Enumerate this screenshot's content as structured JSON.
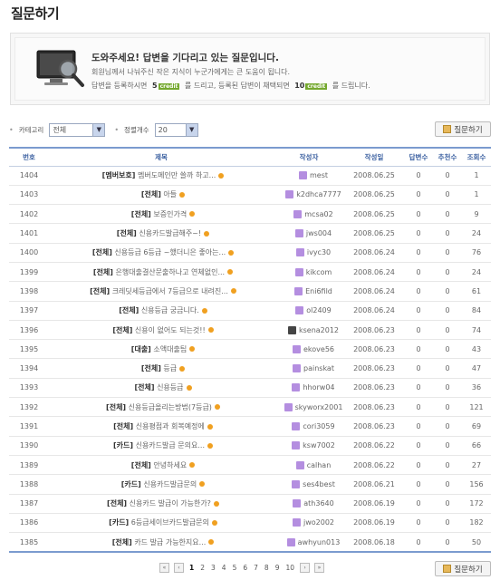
{
  "page": {
    "title": "질문하기"
  },
  "banner": {
    "title": "도와주세요! 답변을 기다리고 있는 질문입니다.",
    "line1": "회원님께서 나눠주신 작은 지식이 누군가에게는 큰 도움이 됩니다.",
    "line2_prefix": "답변을 등록하시면",
    "line2_credit1": "5",
    "line2_mid": "를 드리고, 등록된 답변이 채택되면",
    "line2_credit2": "10",
    "line2_suffix": "를 드립니다.",
    "credit_unit": "credit"
  },
  "filters": {
    "category_label": "카테고리",
    "category_value": "전체",
    "count_label": "정렬개수",
    "count_value": "20"
  },
  "buttons": {
    "ask": "질문하기"
  },
  "table": {
    "headers": {
      "no": "번호",
      "title": "제목",
      "author": "작성자",
      "date": "작성일",
      "answers": "답변수",
      "recommend": "추천수",
      "views": "조회수"
    },
    "rows": [
      {
        "no": "1404",
        "cat": "[멤버보호]",
        "title": "멤버도메인만 쓸까 하고...",
        "new": true,
        "author": "mest",
        "level": "purple",
        "date": "2008.06.25",
        "answers": "0",
        "recommend": "0",
        "views": "1"
      },
      {
        "no": "1403",
        "cat": "[전체]",
        "title": "아들",
        "new": true,
        "author": "k2dhca7777",
        "level": "purple",
        "date": "2008.06.25",
        "answers": "0",
        "recommend": "0",
        "views": "1"
      },
      {
        "no": "1402",
        "cat": "[전체]",
        "title": "보증인가격",
        "new": true,
        "author": "mcsa02",
        "level": "purple",
        "date": "2008.06.25",
        "answers": "0",
        "recommend": "0",
        "views": "9"
      },
      {
        "no": "1401",
        "cat": "[전체]",
        "title": "신용카드발급해주~!",
        "new": true,
        "author": "jws004",
        "level": "purple",
        "date": "2008.06.25",
        "answers": "0",
        "recommend": "0",
        "views": "24"
      },
      {
        "no": "1400",
        "cat": "[전체]",
        "title": "신용등급 6등급 ~했더니은 좋아는...",
        "new": true,
        "author": "ivyc30",
        "level": "purple",
        "date": "2008.06.24",
        "answers": "0",
        "recommend": "0",
        "views": "76"
      },
      {
        "no": "1399",
        "cat": "[전체]",
        "title": "은행대출결산문출하나고 연체없인...",
        "new": true,
        "author": "kikcom",
        "level": "purple",
        "date": "2008.06.24",
        "answers": "0",
        "recommend": "0",
        "views": "24"
      },
      {
        "no": "1398",
        "cat": "[전체]",
        "title": "크레딧세등급에서 7등급으로 내려진...",
        "new": true,
        "author": "Eni6fild",
        "level": "purple",
        "date": "2008.06.24",
        "answers": "0",
        "recommend": "0",
        "views": "61"
      },
      {
        "no": "1397",
        "cat": "[전체]",
        "title": "신용등급 궁금니다.",
        "new": true,
        "author": "ol2409",
        "level": "purple",
        "date": "2008.06.24",
        "answers": "0",
        "recommend": "0",
        "views": "84"
      },
      {
        "no": "1396",
        "cat": "[전체]",
        "title": "신용이 없어도 되는것!!",
        "new": true,
        "author": "ksena2012",
        "level": "dark",
        "date": "2008.06.23",
        "answers": "0",
        "recommend": "0",
        "views": "74"
      },
      {
        "no": "1395",
        "cat": "[대출]",
        "title": "소액대출팁",
        "new": true,
        "author": "ekove56",
        "level": "purple",
        "date": "2008.06.23",
        "answers": "0",
        "recommend": "0",
        "views": "43"
      },
      {
        "no": "1394",
        "cat": "[전체]",
        "title": "등급",
        "new": true,
        "author": "painskat",
        "level": "purple",
        "date": "2008.06.23",
        "answers": "0",
        "recommend": "0",
        "views": "47"
      },
      {
        "no": "1393",
        "cat": "[전체]",
        "title": "신용등급",
        "new": true,
        "author": "hhorw04",
        "level": "purple",
        "date": "2008.06.23",
        "answers": "0",
        "recommend": "0",
        "views": "36"
      },
      {
        "no": "1392",
        "cat": "[전체]",
        "title": "신용등급올리는방법(7등급)",
        "new": true,
        "author": "skyworx2001",
        "level": "purple",
        "date": "2008.06.23",
        "answers": "0",
        "recommend": "0",
        "views": "121"
      },
      {
        "no": "1391",
        "cat": "[전체]",
        "title": "신용평점과 회복예정에",
        "new": true,
        "author": "cori3059",
        "level": "purple",
        "date": "2008.06.23",
        "answers": "0",
        "recommend": "0",
        "views": "69"
      },
      {
        "no": "1390",
        "cat": "[카드]",
        "title": "신용카드발급 문의요...",
        "new": true,
        "author": "ksw7002",
        "level": "purple",
        "date": "2008.06.22",
        "answers": "0",
        "recommend": "0",
        "views": "66"
      },
      {
        "no": "1389",
        "cat": "[전체]",
        "title": "안녕하세요",
        "new": true,
        "author": "calhan",
        "level": "purple",
        "date": "2008.06.22",
        "answers": "0",
        "recommend": "0",
        "views": "27"
      },
      {
        "no": "1388",
        "cat": "[카드]",
        "title": "신용카드발급문의",
        "new": true,
        "author": "ses4best",
        "level": "purple",
        "date": "2008.06.21",
        "answers": "0",
        "recommend": "0",
        "views": "156"
      },
      {
        "no": "1387",
        "cat": "[전체]",
        "title": "신용카드 발급이 가능한가?",
        "new": true,
        "author": "ath3640",
        "level": "purple",
        "date": "2008.06.19",
        "answers": "0",
        "recommend": "0",
        "views": "172"
      },
      {
        "no": "1386",
        "cat": "[카드]",
        "title": "6등급세이브카드발급문의",
        "new": true,
        "author": "jwo2002",
        "level": "purple",
        "date": "2008.06.19",
        "answers": "0",
        "recommend": "0",
        "views": "182"
      },
      {
        "no": "1385",
        "cat": "[전체]",
        "title": "카드 발급 가능한지요...",
        "new": true,
        "author": "awhyun013",
        "level": "purple",
        "date": "2008.06.18",
        "answers": "0",
        "recommend": "0",
        "views": "50"
      }
    ]
  },
  "pagination": {
    "first": "«",
    "prev": "‹",
    "next": "›",
    "last": "»",
    "pages": [
      "1",
      "2",
      "3",
      "4",
      "5",
      "6",
      "7",
      "8",
      "9",
      "10"
    ],
    "current": "1"
  },
  "colors": {
    "accent": "#7b9bcf",
    "header_text": "#3a5fa0",
    "new_dot": "#f0a020",
    "level_purple": "#b48ee0",
    "credit": "#74a82e"
  }
}
